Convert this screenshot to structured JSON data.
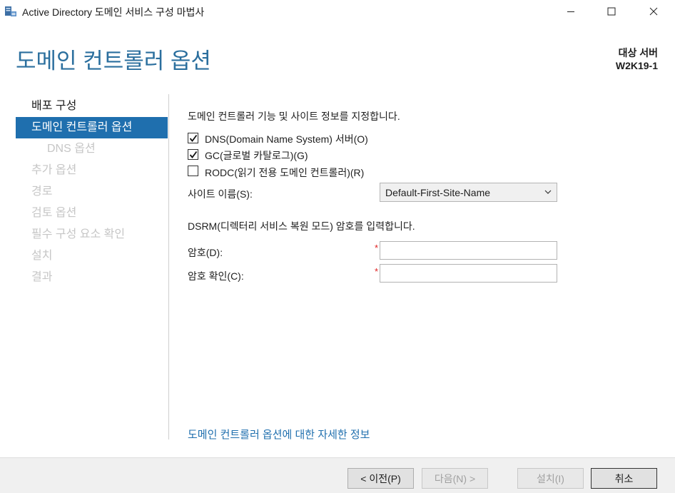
{
  "window": {
    "title": "Active Directory 도메인 서비스 구성 마법사"
  },
  "header": {
    "page_title": "도메인 컨트롤러 옵션",
    "target_label": "대상 서버",
    "target_name": "W2K19-1"
  },
  "nav": {
    "items": [
      {
        "label": "배포 구성",
        "state": "normal"
      },
      {
        "label": "도메인 컨트롤러 옵션",
        "state": "active"
      },
      {
        "label": "DNS 옵션",
        "state": "disabled"
      },
      {
        "label": "추가 옵션",
        "state": "disabled"
      },
      {
        "label": "경로",
        "state": "disabled"
      },
      {
        "label": "검토 옵션",
        "state": "disabled"
      },
      {
        "label": "필수 구성 요소 확인",
        "state": "disabled"
      },
      {
        "label": "설치",
        "state": "disabled"
      },
      {
        "label": "결과",
        "state": "disabled"
      }
    ]
  },
  "main": {
    "intro": "도메인 컨트롤러 기능 및 사이트 정보를 지정합니다.",
    "options": [
      {
        "label": "DNS(Domain Name System) 서버(O)",
        "checked": true
      },
      {
        "label": "GC(글로벌 카탈로그)(G)",
        "checked": true
      },
      {
        "label": "RODC(읽기 전용 도메인 컨트롤러)(R)",
        "checked": false
      }
    ],
    "site": {
      "label": "사이트 이름(S):",
      "value": "Default-First-Site-Name"
    },
    "dsrm_intro": "DSRM(디렉터리 서비스 복원 모드) 암호를 입력합니다.",
    "password": {
      "label": "암호(D):",
      "value": "",
      "required_mark": "*"
    },
    "confirm": {
      "label": "암호 확인(C):",
      "value": "",
      "required_mark": "*"
    },
    "more_info_link": "도메인 컨트롤러 옵션에 대한 자세한 정보"
  },
  "footer": {
    "back": "< 이전(P)",
    "next": "다음(N) >",
    "install": "설치(I)",
    "cancel": "취소"
  },
  "colors": {
    "accent": "#1f6fae",
    "title": "#2b6f9e",
    "required": "#e02020"
  }
}
